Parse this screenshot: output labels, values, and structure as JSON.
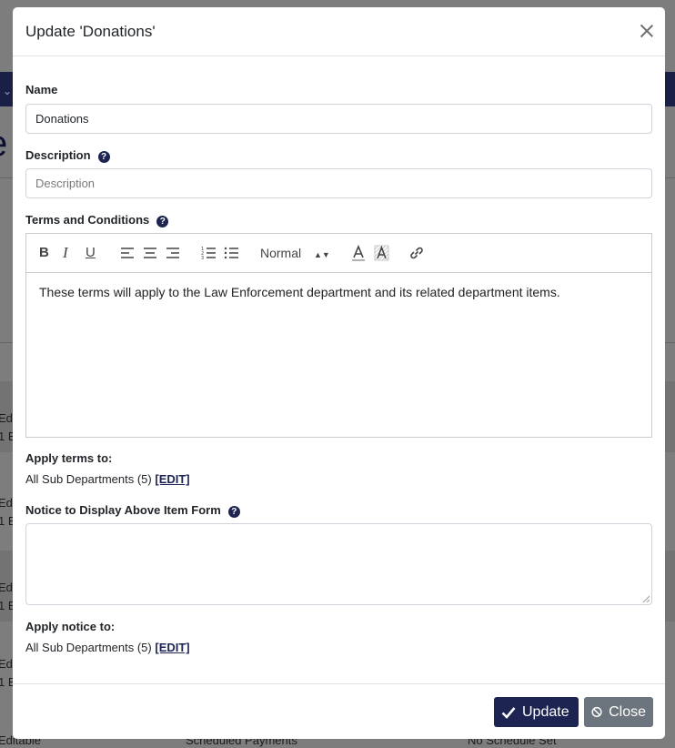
{
  "background": {
    "title_fragment": "e",
    "rows": [
      "Editable",
      "1 E",
      "Editable",
      "1 E",
      "Editable",
      "1 E",
      "Editable",
      "1 E"
    ],
    "bottom": {
      "left": "Editable",
      "middle": "Scheduled Payments",
      "right": "No Schedule Set"
    }
  },
  "modal": {
    "title": "Update 'Donations'",
    "name_label": "Name",
    "name_value": "Donations",
    "description_label": "Description",
    "description_placeholder": "Description",
    "terms_label": "Terms and Conditions",
    "help_glyph": "?",
    "toolbar": {
      "format_select": "Normal"
    },
    "terms_content": "These terms will apply to the Law Enforcement department and its related department items.",
    "apply_terms_label": "Apply terms to:",
    "apply_terms_value": "All Sub Departments (5)",
    "edit_link": "[EDIT]",
    "notice_label": "Notice to Display Above Item Form",
    "apply_notice_label": "Apply notice to:",
    "apply_notice_value": "All Sub Departments (5)",
    "update_button": "Update",
    "close_button": "Close"
  },
  "colors": {
    "primary": "#1d2451",
    "secondary": "#6c757d",
    "navbar": "#1a2045"
  }
}
